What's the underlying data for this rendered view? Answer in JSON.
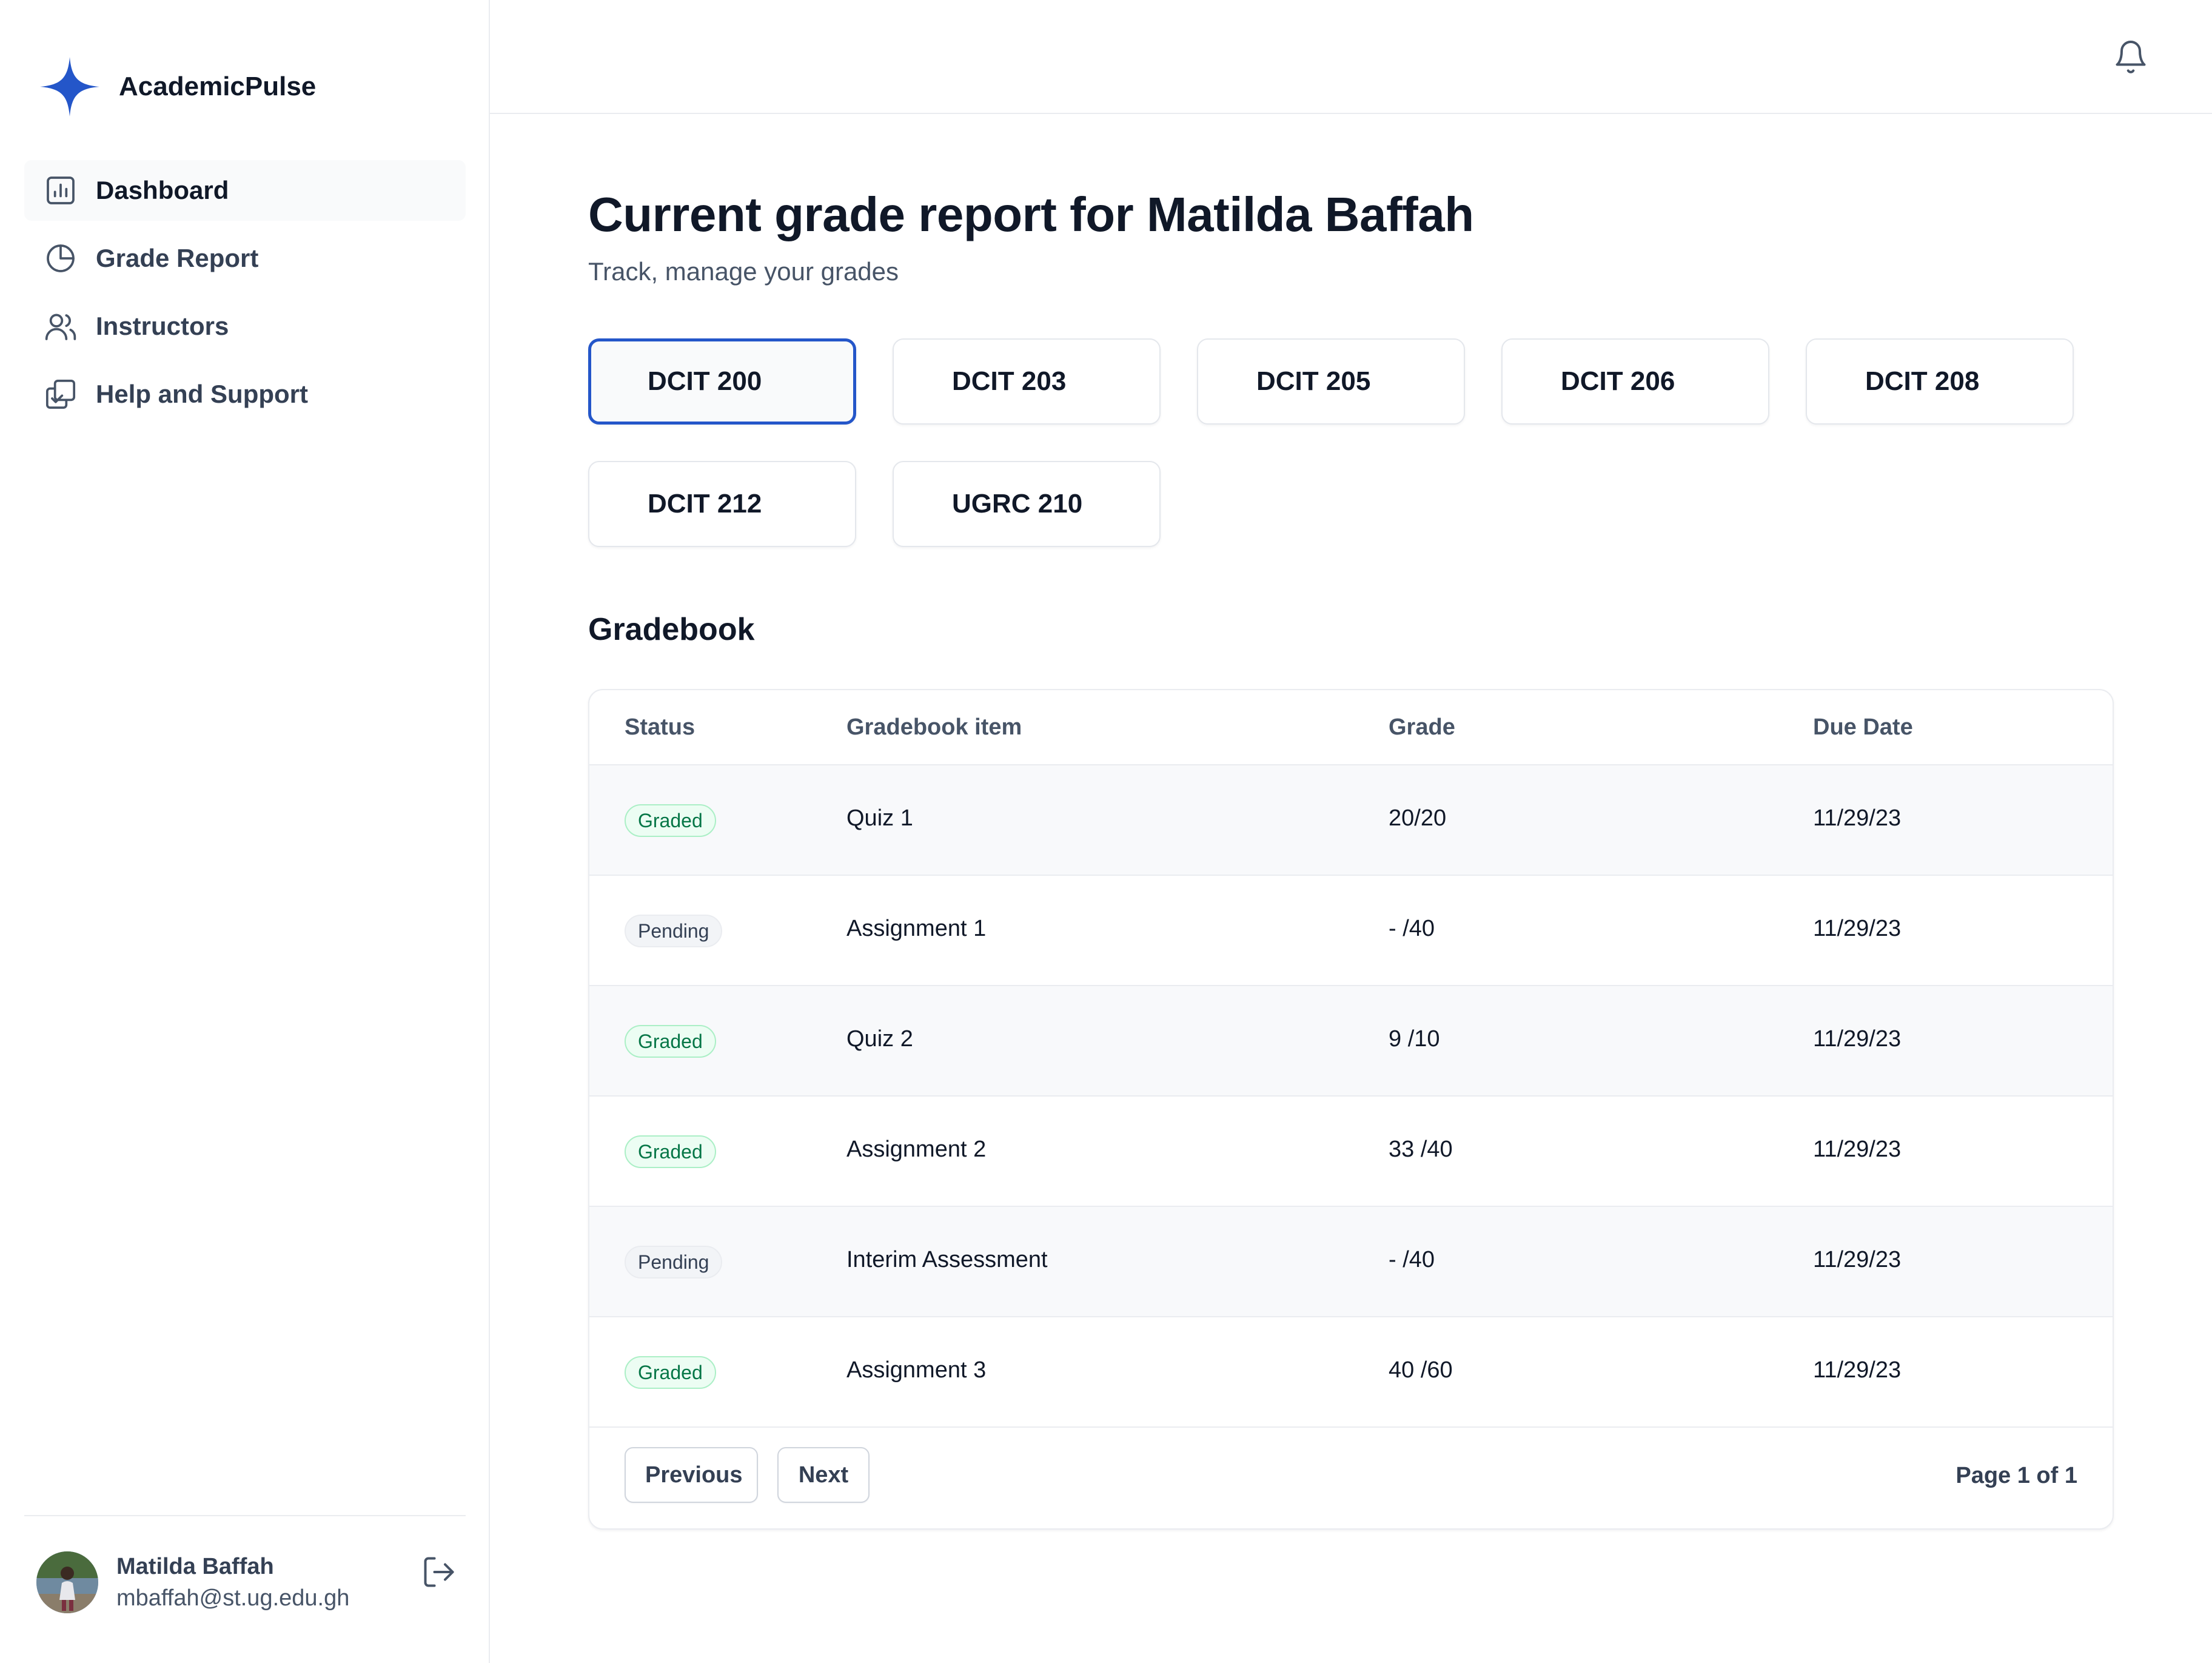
{
  "app": {
    "name": "AcademicPulse",
    "brand_color": "#2456c9"
  },
  "sidebar": {
    "items": [
      {
        "label": "Dashboard",
        "icon": "bar-chart-icon",
        "active": true
      },
      {
        "label": "Grade Report",
        "icon": "pie-chart-icon",
        "active": false
      },
      {
        "label": "Instructors",
        "icon": "users-icon",
        "active": false
      },
      {
        "label": "Help and Support",
        "icon": "copy-check-icon",
        "active": false
      }
    ],
    "user": {
      "name": "Matilda Baffah",
      "email": "mbaffah@st.ug.edu.gh"
    }
  },
  "header": {
    "notification_icon": "bell-icon"
  },
  "main": {
    "title": "Current grade report for Matilda Baffah",
    "subtitle": "Track, manage your grades",
    "courses": [
      "DCIT 200",
      "DCIT 203",
      "DCIT 205",
      "DCIT 206",
      "DCIT 208",
      "DCIT 212",
      "UGRC 210"
    ],
    "selected_course": "DCIT 200",
    "gradebook": {
      "title": "Gradebook",
      "columns": [
        "Status",
        "Gradebook item",
        "Grade",
        "Due Date"
      ],
      "rows": [
        {
          "status": "Graded",
          "item": "Quiz 1",
          "grade": "20/20",
          "due": "11/29/23"
        },
        {
          "status": "Pending",
          "item": "Assignment 1",
          "grade": "- /40",
          "due": "11/29/23"
        },
        {
          "status": "Graded",
          "item": "Quiz 2",
          "grade": "9 /10",
          "due": "11/29/23"
        },
        {
          "status": "Graded",
          "item": "Assignment 2",
          "grade": "33 /40",
          "due": "11/29/23"
        },
        {
          "status": "Pending",
          "item": "Interim Assessment",
          "grade": "- /40",
          "due": "11/29/23"
        },
        {
          "status": "Graded",
          "item": "Assignment 3",
          "grade": "40 /60",
          "due": "11/29/23"
        }
      ],
      "pagination": {
        "previous_label": "Previous",
        "next_label": "Next",
        "page_info": "Page 1 of 1"
      }
    }
  }
}
